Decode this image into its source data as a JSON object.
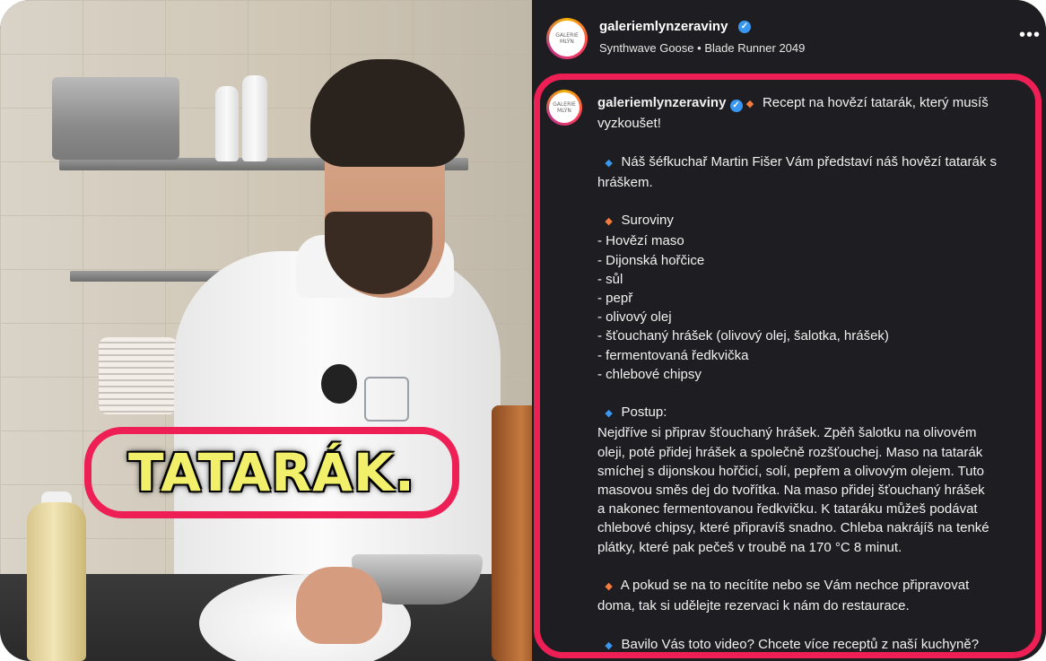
{
  "video": {
    "overlay_caption": "TATARÁK."
  },
  "post": {
    "username": "galeriemlynzeraviny",
    "verified": true,
    "audio": "Synthwave Goose",
    "audio_separator": "•",
    "audio_track": "Blade Runner 2049",
    "more_icon": "more-horizontal-icon",
    "avatar_text": "GALERIE MLÝN"
  },
  "caption": {
    "username": "galeriemlynzeraviny",
    "line1": "Recept na hovězí tatarák, který musíš",
    "line2": "vyzkoušet!",
    "intro1": "Náš šéfkuchař Martin Fišer Vám představí náš hovězí tatarák s",
    "intro2": "hráškem.",
    "ingredients_title": "Suroviny",
    "ingredients": [
      "- Hovězí maso",
      "- Dijonská hořčice",
      "- sůl",
      "- pepř",
      "- olivový olej",
      "- šťouchaný hrášek (olivový olej, šalotka, hrášek)",
      "- fermentovaná ředkvička",
      "- chlebové chipsy"
    ],
    "method_title": "Postup:",
    "method": [
      "Nejdříve si připrav šťouchaný hrášek. Zpěň šalotku na olivovém",
      "oleji, poté přidej hrášek a společně rozšťouchej. Maso na tatarák",
      "smíchej s dijonskou hořčicí, solí, pepřem a olivovým olejem. Tuto",
      "masovou směs dej do tvořítka. Na maso přidej šťouchaný hrášek",
      "a nakonec fermentovanou ředkvičku. K tataráku můžeš podávat",
      "chlebové chipsy, které připravíš snadno. Chleba nakrájíš na tenké",
      "plátky, které pak pečeš v troubě na 170 °C 8 minut."
    ],
    "reservation1": "A pokud se na to necítíte nebo se Vám nechce připravovat",
    "reservation2": "doma, tak si udělejte rezervaci k nám do restaurace.",
    "cta": "Bavilo Vás toto video? Chcete více receptů z naší kuchyně?"
  },
  "colors": {
    "highlight": "#ee1f55",
    "panel_bg": "#1e1e22",
    "verified": "#3897f0",
    "blue_diamond": "#3897f0",
    "orange_diamond": "#f47c3c",
    "caption_text": "#f2f06a"
  }
}
